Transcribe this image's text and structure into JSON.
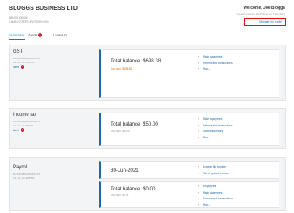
{
  "header": {
    "business_name": "BLOGGS BUSINESS LTD",
    "business_id": "ABN 00 000 000",
    "business_address": "1 MAIN STREET, ANYTOWN 0000",
    "welcome": "Welcome, Joe Bloggs",
    "logged_in_note": "You last logged in at 10:00 am on 1 July 2021",
    "manage_profile": "Manage my profile"
  },
  "tabs": {
    "summary": "Summary",
    "alerts": "Alerts",
    "alerts_badge": "1",
    "i_want_to": "I want to..."
  },
  "accounts": {
    "gst": {
      "title": "GST",
      "business": "BLOGGS BUSINESS LTD",
      "number": "111 111 111 GST001",
      "alerts_label": "Alerts",
      "alerts_badge": "1",
      "balance": "Total balance: $698.38",
      "due": "Due now: $698.38",
      "links": [
        "Make a payment",
        "Returns and transactions",
        "More..."
      ]
    },
    "income": {
      "title": "Income tax",
      "business": "BLOGGS BUSINESS LTD",
      "number": "111 111 111 INC001",
      "alerts_label": "Alerts",
      "alerts_badge": "1",
      "balance": "Total balance: $50.00",
      "due": "Due now: $50.00",
      "links": [
        "Make a payment",
        "Returns and transactions",
        "Income summary",
        "More..."
      ]
    },
    "payroll": {
      "title": "Payroll",
      "business": "BLOGGS BUSINESS LTD",
      "number": "111 111 111 EMP001",
      "date": "30-Jun-2021",
      "date_links": [
        "Express file transfer",
        "File or upload a return"
      ],
      "balance": "Total balance: $0.00",
      "due": "Due now: $0.00",
      "links": [
        "Employees",
        "Make a payment",
        "Returns and transactions",
        "More..."
      ]
    }
  },
  "colors": {
    "link": "#1e6aa8",
    "tab_active": "#1e7fb8",
    "badge": "#c0182a",
    "due_now": "#d46a19",
    "highlight_box": "#e01010"
  },
  "icons": [
    "chevron-right-icon",
    "alert-badge-icon"
  ]
}
